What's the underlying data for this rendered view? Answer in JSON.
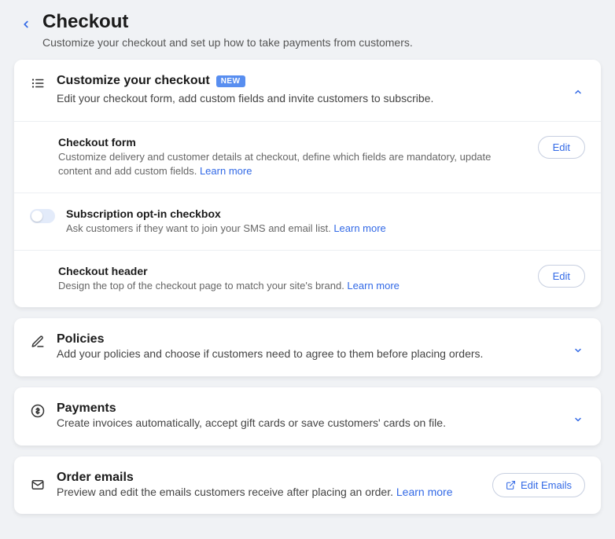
{
  "header": {
    "title": "Checkout",
    "subtitle": "Customize your checkout and set up how to take payments from customers."
  },
  "customize": {
    "title": "Customize your checkout",
    "badge": "NEW",
    "subtitle": "Edit your checkout form, add custom fields and invite customers to subscribe.",
    "rows": {
      "form": {
        "title": "Checkout form",
        "desc": "Customize delivery and customer details at checkout, define which fields are mandatory, update content and add custom fields. ",
        "learn": "Learn more",
        "edit": "Edit"
      },
      "subscription": {
        "title": "Subscription opt-in checkbox",
        "desc": "Ask customers if they want to join your SMS and email list. ",
        "learn": "Learn more"
      },
      "header": {
        "title": "Checkout header",
        "desc": "Design the top of the checkout page to match your site's brand. ",
        "learn": "Learn more",
        "edit": "Edit"
      }
    }
  },
  "policies": {
    "title": "Policies",
    "subtitle": "Add your policies and choose if customers need to agree to them before placing orders."
  },
  "payments": {
    "title": "Payments",
    "subtitle": "Create invoices automatically, accept gift cards or save customers' cards on file."
  },
  "emails": {
    "title": "Order emails",
    "subtitle_pre": "Preview and edit the emails customers receive after placing an order. ",
    "learn": "Learn more",
    "button": "Edit Emails"
  }
}
